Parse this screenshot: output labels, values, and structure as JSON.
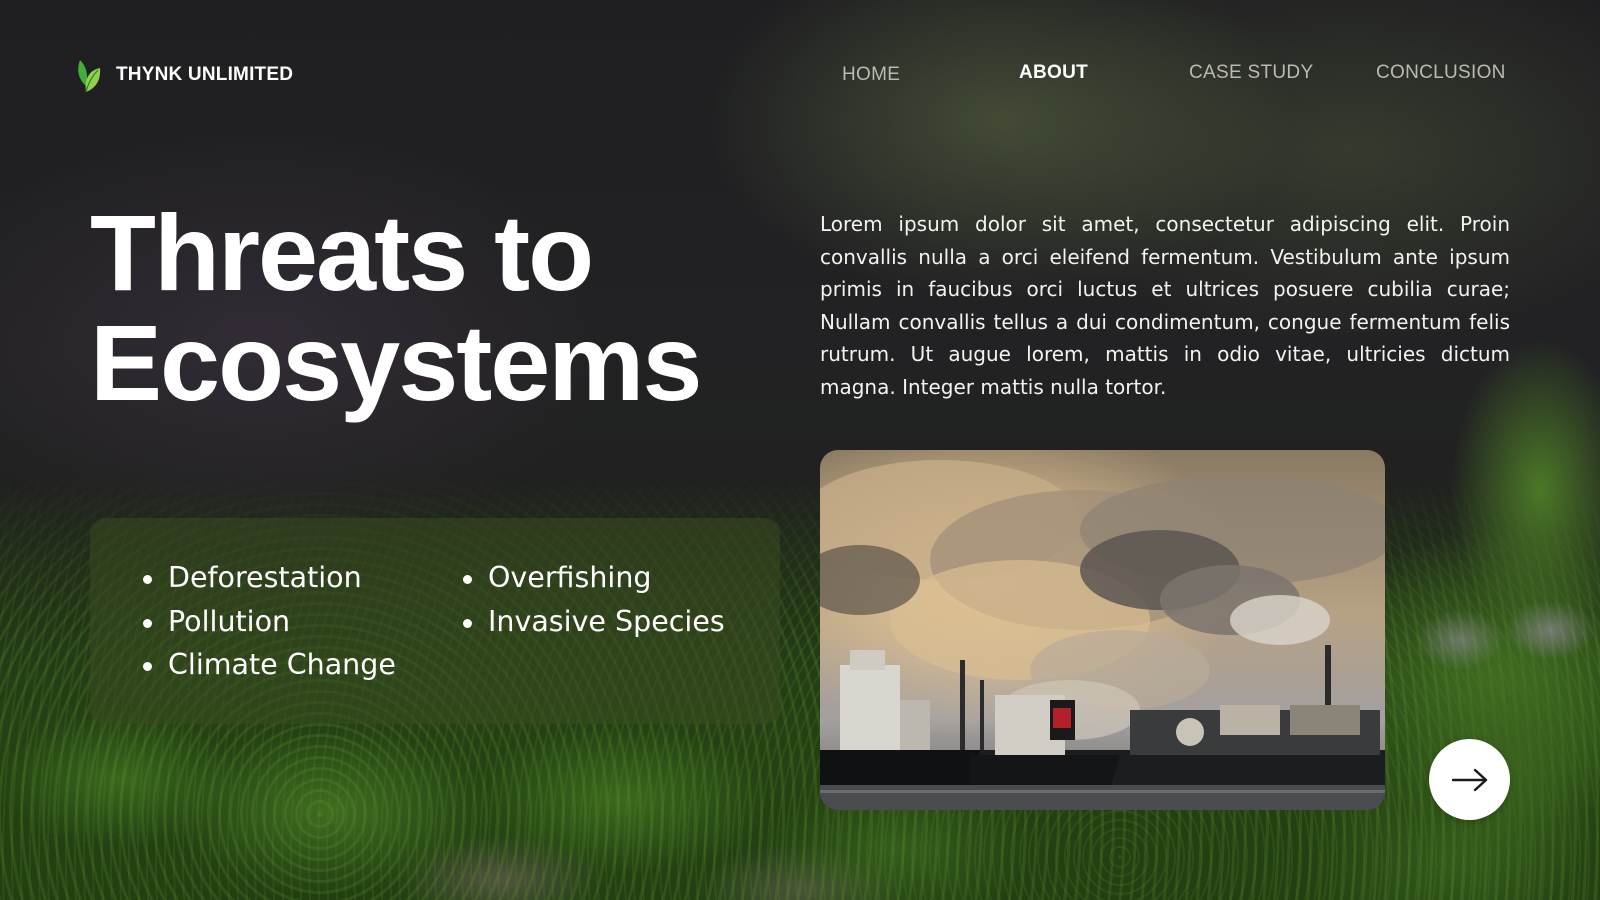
{
  "brand": {
    "name": "THYNK UNLIMITED",
    "logo_icon": "leaf-icon",
    "logo_colors": [
      "#3fae3a",
      "#8fd14f"
    ]
  },
  "nav": {
    "items": [
      {
        "label": "HOME",
        "active": false
      },
      {
        "label": "ABOUT",
        "active": true
      },
      {
        "label": "CASE STUDY",
        "active": false
      },
      {
        "label": "CONCLUSION",
        "active": false
      }
    ]
  },
  "hero": {
    "title_line1": "Threats to",
    "title_line2": "Ecosystems",
    "intro": "Lorem ipsum dolor sit amet, consectetur adipiscing elit. Proin convallis nulla a orci eleifend fermentum. Vestibulum ante ipsum primis in faucibus orci luctus et ultrices posuere cubilia curae; Nullam convallis tellus a dui condimentum, congue fermentum felis rutrum. Ut augue lorem, mattis in odio vitae, ultricies dictum magna. Integer mattis nulla tortor."
  },
  "threats": {
    "column1": [
      "Deforestation",
      "Pollution",
      "Climate Change"
    ],
    "column2": [
      "Overfishing",
      "Invasive Species"
    ]
  },
  "photo": {
    "subject_icon": "industrial-smoke-photo"
  },
  "navigation": {
    "next_icon": "arrow-right-icon"
  },
  "colors": {
    "text": "#ffffff",
    "nav_inactive": "#b9bab3",
    "card_background": "#3a4a20"
  }
}
